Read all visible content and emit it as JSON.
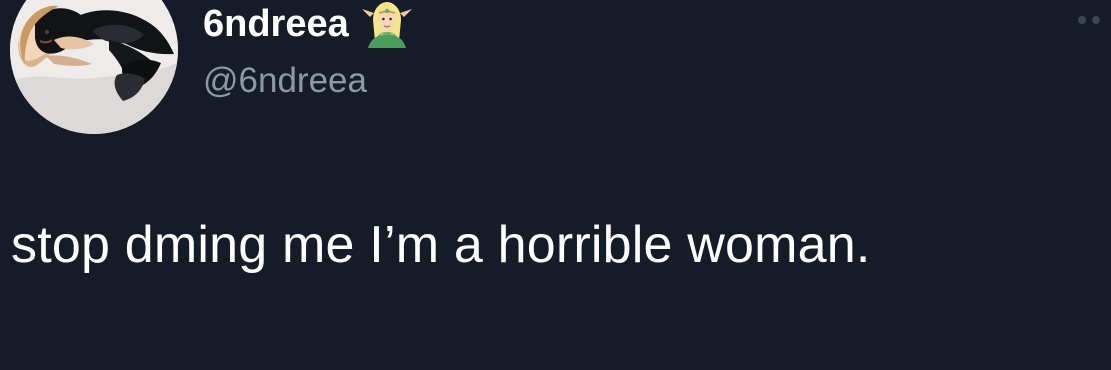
{
  "tweet": {
    "display_name": "6ndreea",
    "handle": "@6ndreea",
    "name_emoji": "elf-woman-emoji",
    "text": "stop dming me I’m a horrible woman."
  },
  "icons": {
    "more": "more-options-dots-icon",
    "avatar": "profile-photo"
  },
  "colors": {
    "background": "#151c28",
    "primary_text": "#ffffff",
    "secondary_text": "#8b98a5"
  }
}
